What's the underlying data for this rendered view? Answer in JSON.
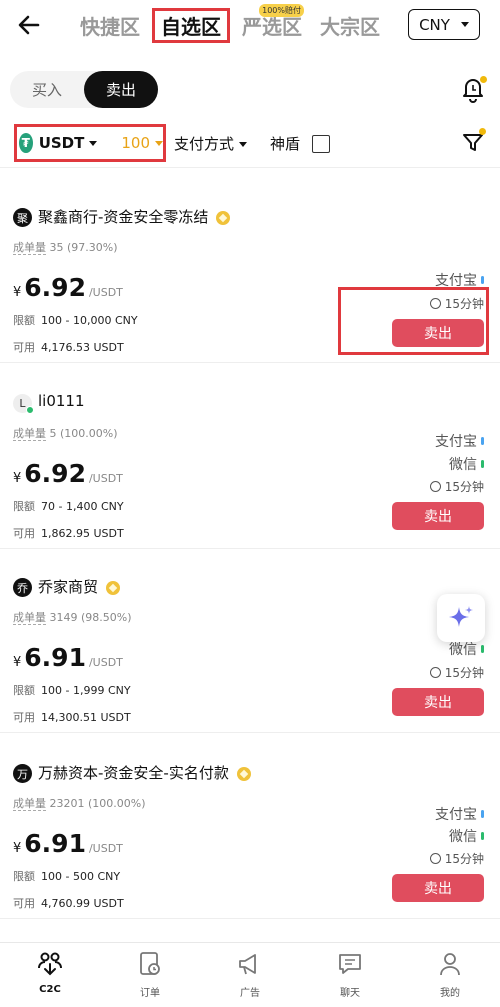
{
  "header": {
    "tabs": [
      {
        "label": "快捷区"
      },
      {
        "label": "自选区"
      },
      {
        "label": "严选区",
        "badge": "100%赔付"
      },
      {
        "label": "大宗区"
      }
    ],
    "active_tab": "自选区",
    "currency": "CNY"
  },
  "mode": {
    "buy": "买入",
    "sell": "卖出",
    "active": "卖出"
  },
  "filters": {
    "coin": "USDT",
    "coin_icon": "tether-icon",
    "amount": "100",
    "payment": "支付方式",
    "shield": "神盾"
  },
  "colors": {
    "accent_red": "#e04d5e",
    "highlight_box": "#e0393e",
    "gold": "#e8a317",
    "online": "#2bbb6d"
  },
  "labels": {
    "orders_label": "成单量",
    "limit_label": "限额",
    "available_label": "可用",
    "unit": "/USDT",
    "yen": "¥",
    "sell_button": "卖出"
  },
  "listings": [
    {
      "avatar": "聚",
      "name": "聚鑫商行-资金安全零冻结",
      "verified": true,
      "orders": "35 (97.30%)",
      "price": "6.92",
      "limit": "100 - 10,000 CNY",
      "available": "4,176.53 USDT",
      "payments": [
        {
          "name": "支付宝",
          "color": "#4aa3f0"
        }
      ],
      "time": "15分钟"
    },
    {
      "avatar": "L",
      "name": "li0111",
      "verified": false,
      "orders": "5 (100.00%)",
      "price": "6.92",
      "limit": "70 - 1,400 CNY",
      "available": "1,862.95 USDT",
      "payments": [
        {
          "name": "支付宝",
          "color": "#4aa3f0"
        },
        {
          "name": "微信",
          "color": "#2bbb6d"
        }
      ],
      "time": "15分钟"
    },
    {
      "avatar": "乔",
      "name": "乔家商贸",
      "verified": true,
      "orders": "3149 (98.50%)",
      "price": "6.91",
      "limit": "100 - 1,999 CNY",
      "available": "14,300.51 USDT",
      "payments": [
        {
          "name": "微信",
          "color": "#2bbb6d"
        }
      ],
      "time": "15分钟"
    },
    {
      "avatar": "万",
      "name": "万赫资本-资金安全-实名付款",
      "verified": true,
      "orders": "23201 (100.00%)",
      "price": "6.91",
      "limit": "100 - 500 CNY",
      "available": "4,760.99 USDT",
      "payments": [
        {
          "name": "支付宝",
          "color": "#4aa3f0"
        },
        {
          "name": "微信",
          "color": "#2bbb6d"
        }
      ],
      "time": "15分钟"
    }
  ],
  "nav": [
    {
      "label": "C2C",
      "icon": "c2c-users-icon",
      "active": true
    },
    {
      "label": "订单",
      "icon": "orders-icon",
      "active": false
    },
    {
      "label": "广告",
      "icon": "megaphone-icon",
      "active": false
    },
    {
      "label": "聊天",
      "icon": "chat-icon",
      "active": false
    },
    {
      "label": "我的",
      "icon": "profile-icon",
      "active": false
    }
  ]
}
